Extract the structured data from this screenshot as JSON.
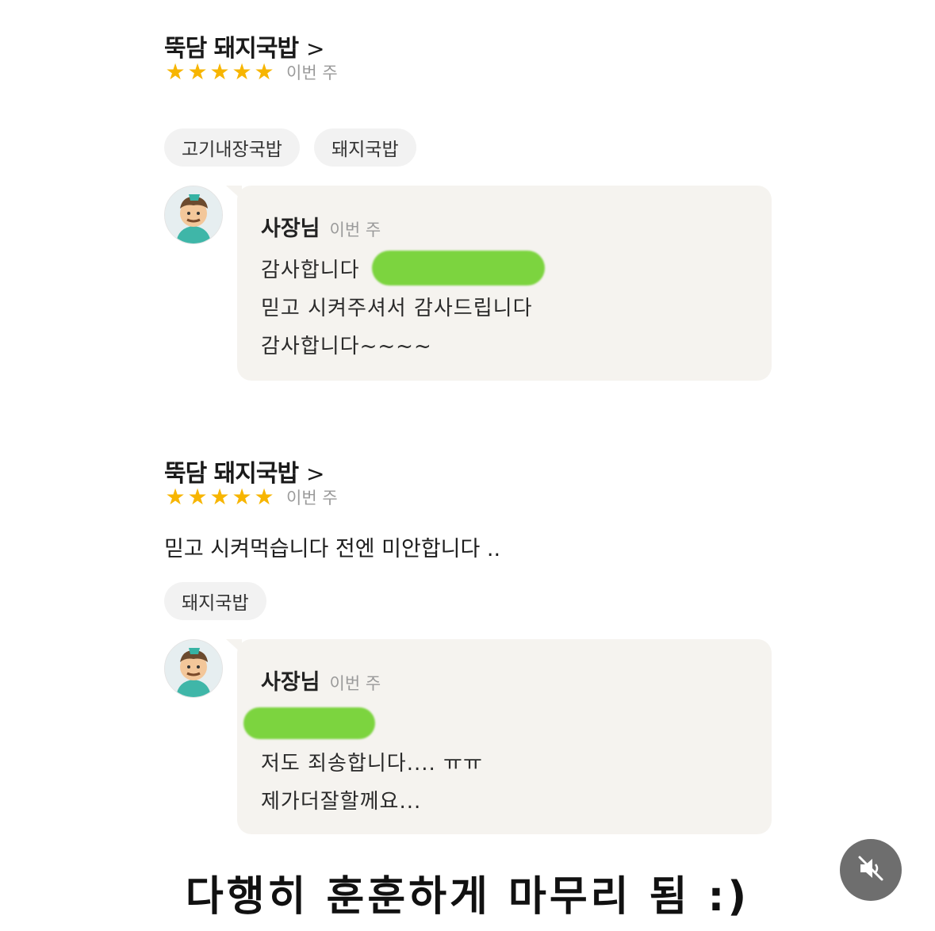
{
  "reviews": [
    {
      "store_name": "뚝담 돼지국밥",
      "chevron": ">",
      "rating": 5,
      "stars": [
        "★",
        "★",
        "★",
        "★",
        "★"
      ],
      "date": "이번 주",
      "text": "",
      "tags": [
        "고기내장국밥",
        "돼지국밥"
      ],
      "reply": {
        "owner_name": "사장님",
        "date": "이번 주",
        "lines": [
          "감사합니다",
          "믿고 시켜주셔서 감사드립니다",
          "감사합니다~~~~"
        ]
      }
    },
    {
      "store_name": "뚝담 돼지국밥",
      "chevron": ">",
      "rating": 5,
      "stars": [
        "★",
        "★",
        "★",
        "★",
        "★"
      ],
      "date": "이번 주",
      "text": "믿고 시켜먹습니다 전엔 미안합니다 ..",
      "tags": [
        "돼지국밥"
      ],
      "reply": {
        "owner_name": "사장님",
        "date": "이번 주",
        "lines": [
          "",
          "저도 죄송합니다.... ㅠㅠ",
          "제가더잘할께요..."
        ]
      }
    }
  ],
  "caption": "다행히 훈훈하게 마무리 됨 :)",
  "colors": {
    "star": "#f7b500",
    "redact": "#7cd43f",
    "bubble": "#f5f3ef"
  },
  "icons": {
    "mute": "speaker-muted-icon",
    "avatar": "owner-avatar-icon"
  }
}
